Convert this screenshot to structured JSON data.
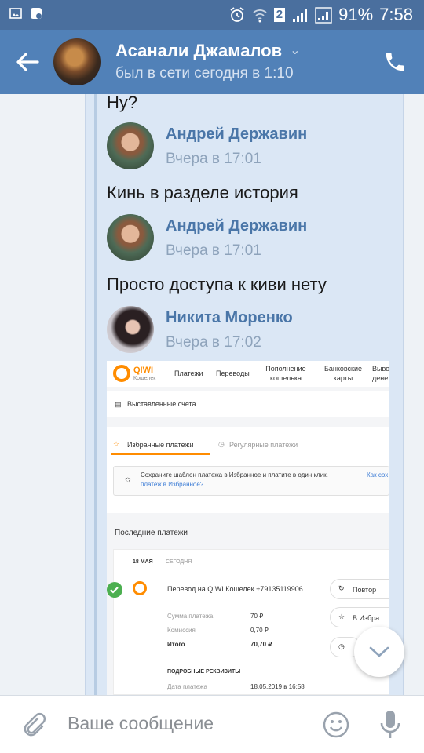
{
  "statusbar": {
    "sim_badge": "2",
    "battery": "91%",
    "time": "7:58"
  },
  "header": {
    "contact_name": "Асанали Джамалов",
    "last_seen": "был в сети сегодня в 1:10"
  },
  "messages": [
    {
      "text": "Ну?"
    },
    {
      "author": "Андрей Державин",
      "time": "Вчера в 17:01",
      "text": "Кинь в разделе история"
    },
    {
      "author": "Андрей Державин",
      "time": "Вчера в 17:01",
      "text": "Просто доступа к киви нету"
    },
    {
      "author": "Никита Моренко",
      "time": "Вчера в 17:02"
    }
  ],
  "attachment": {
    "logo_name": "QIWI",
    "logo_sub": "Кошелек",
    "nav": [
      "Платежи",
      "Переводы",
      "Пополнение кошелька",
      "Банковские карты",
      "Выво дене"
    ],
    "invoices": "Выставленные счета",
    "tab_favorites": "Избранные платежи",
    "tab_regular": "Регулярные платежи",
    "hint": "Сохраните шаблон платежа в Избранное и платите в один клик.",
    "hint_link_1": "Как сох",
    "hint_link_2": "платеж в Избранное?",
    "recent": "Последние платежи",
    "date": "18 МАЯ",
    "date_rel": "СЕГОДНЯ",
    "payment_title": "Перевод на QIWI Кошелек +79135119906",
    "rows": [
      {
        "label": "Сумма платежа",
        "value": "70 ₽"
      },
      {
        "label": "Комиссия",
        "value": "0,70 ₽"
      },
      {
        "label": "Итого",
        "value": "70,70 ₽"
      }
    ],
    "details": "ПОДРОБНЫЕ РЕКВИЗИТЫ",
    "pay_date_label": "Дата платежа",
    "pay_date_value": "18.05.2019 в 16:58",
    "btn_repeat": "Повтор",
    "btn_fav": "В Избра"
  },
  "composer": {
    "placeholder": "Ваше сообщение"
  },
  "colors": {
    "header": "#5181b8",
    "statusbar": "#4a6f9e",
    "link_name": "#4a76a8",
    "qiwi": "#ff8c00"
  }
}
